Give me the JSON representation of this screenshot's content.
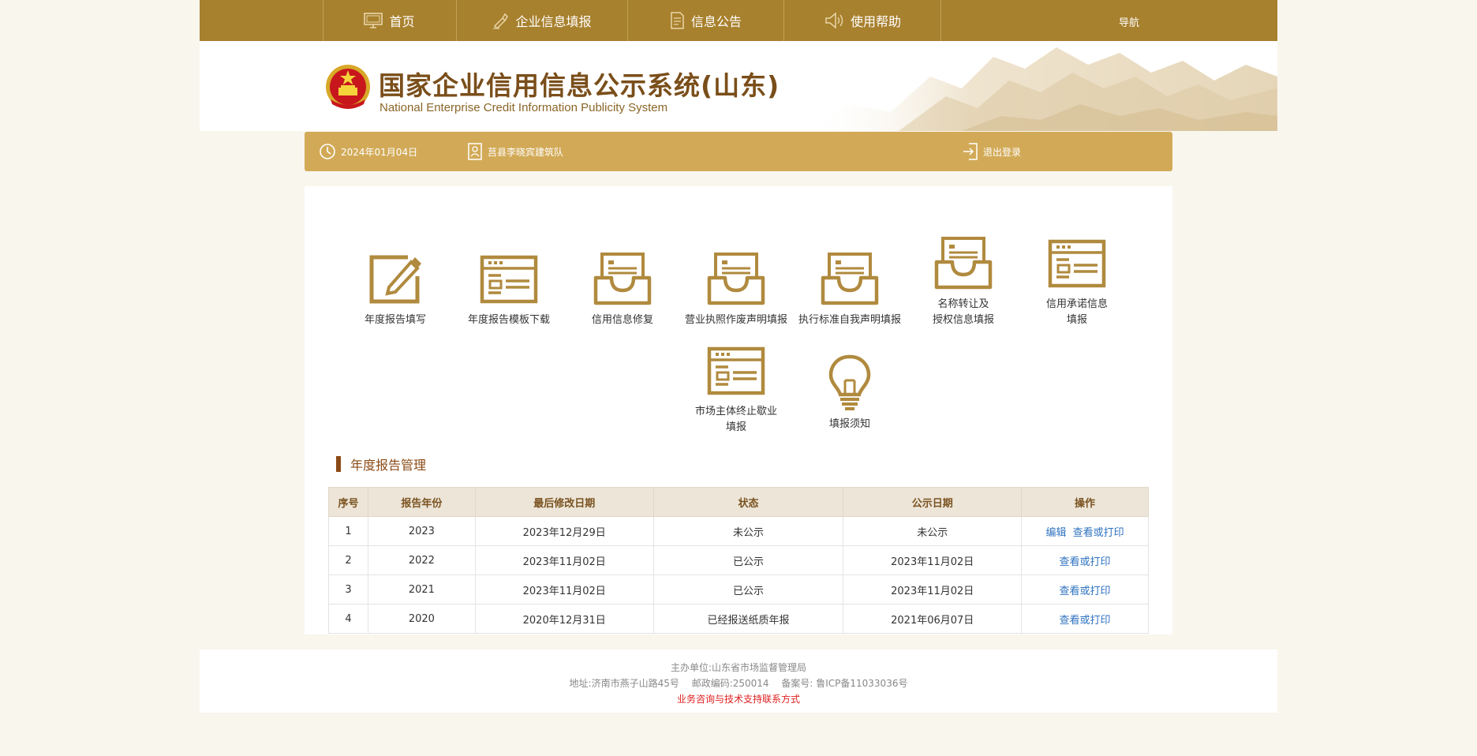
{
  "nav": {
    "items": [
      {
        "label": "首页",
        "icon": "monitor-icon"
      },
      {
        "label": "企业信息填报",
        "icon": "pen-icon"
      },
      {
        "label": "信息公告",
        "icon": "document-icon"
      },
      {
        "label": "使用帮助",
        "icon": "speaker-icon"
      }
    ],
    "right_label": "导航"
  },
  "banner": {
    "title_cn": "国家企业信用信息公示系统(山东)",
    "title_en": "National Enterprise Credit Information Publicity System"
  },
  "userbar": {
    "date": "2024年01月04日",
    "company": "莒县李晓宾建筑队",
    "logout": "退出登录"
  },
  "functions": [
    {
      "label": "年度报告填写",
      "icon": "edit-report-icon"
    },
    {
      "label": "年度报告模板下载",
      "icon": "template-icon"
    },
    {
      "label": "信用信息修复",
      "icon": "inbox-icon"
    },
    {
      "label": "营业执照作废声明填报",
      "icon": "inbox-icon"
    },
    {
      "label": "执行标准自我声明填报",
      "icon": "inbox-icon"
    },
    {
      "label_line1": "名称转让及",
      "label_line2": "授权信息填报",
      "icon": "inbox-icon"
    },
    {
      "label_line1": "信用承诺信息",
      "label_line2": "填报",
      "icon": "template-icon"
    },
    {
      "label_line1": "市场主体终止歇业",
      "label_line2": "填报",
      "icon": "template-icon"
    },
    {
      "label": "填报须知",
      "icon": "lightbulb-icon"
    }
  ],
  "section": {
    "title": "年度报告管理"
  },
  "table": {
    "headers": [
      "序号",
      "报告年份",
      "最后修改日期",
      "状态",
      "公示日期",
      "操作"
    ],
    "rows": [
      {
        "no": "1",
        "year": "2023",
        "modified": "2023年12月29日",
        "status": "未公示",
        "publish": "未公示",
        "actions": [
          "编辑",
          "查看或打印"
        ]
      },
      {
        "no": "2",
        "year": "2022",
        "modified": "2023年11月02日",
        "status": "已公示",
        "publish": "2023年11月02日",
        "actions": [
          "查看或打印"
        ]
      },
      {
        "no": "3",
        "year": "2021",
        "modified": "2023年11月02日",
        "status": "已公示",
        "publish": "2023年11月02日",
        "actions": [
          "查看或打印"
        ]
      },
      {
        "no": "4",
        "year": "2020",
        "modified": "2020年12月31日",
        "status": "已经报送纸质年报",
        "publish": "2021年06月07日",
        "actions": [
          "查看或打印"
        ]
      }
    ]
  },
  "footer": {
    "host": "主办单位:山东省市场监督管理局",
    "address": "地址:济南市燕子山路45号",
    "postcode": "邮政编码:250014",
    "icp": "备案号: 鲁ICP备11033036号",
    "contact": "业务咨询与技术支持联系方式"
  },
  "colors": {
    "nav_bg": "#a8812e",
    "userbar_bg": "#d2aa57",
    "icon_gold": "#b08a3e",
    "link_blue": "#2f73c0",
    "section_brown": "#8b4a16",
    "footer_red": "#e02020"
  }
}
